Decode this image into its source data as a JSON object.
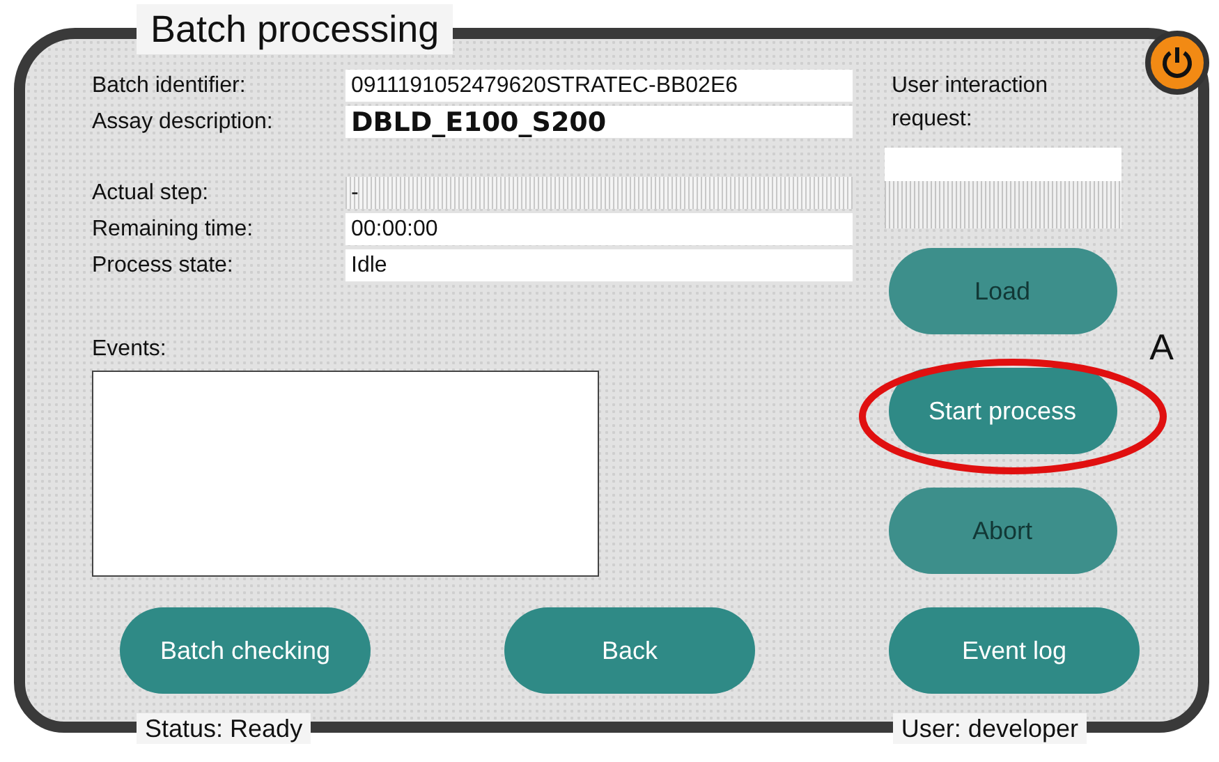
{
  "window": {
    "title": "Batch processing"
  },
  "field_groups": [
    [
      {
        "label": "Batch identifier:",
        "value": "0911191052479620STRATEC-BB02E6",
        "kind": "plain"
      },
      {
        "label": "Assay description:",
        "value": "DBLD_E100_S200",
        "kind": "bold"
      }
    ],
    [
      {
        "label": "Actual step:",
        "value": "-",
        "kind": "hatched"
      },
      {
        "label": "Remaining time:",
        "value": "00:00:00",
        "kind": "plain"
      },
      {
        "label": "Process state:",
        "value": "Idle",
        "kind": "plain"
      }
    ]
  ],
  "events": {
    "label": "Events:"
  },
  "user_interaction": {
    "label": "User interaction request:"
  },
  "side_buttons": [
    {
      "label": "Load",
      "disabled": true,
      "highlighted": false
    },
    {
      "label": "Start process",
      "disabled": false,
      "highlighted": true
    },
    {
      "label": "Abort",
      "disabled": true,
      "highlighted": false
    }
  ],
  "annotation": "A",
  "bottom_buttons": [
    "Batch checking",
    "Back",
    "Event log"
  ],
  "status_bar": {
    "status": "Status: Ready",
    "user": "User: developer"
  }
}
